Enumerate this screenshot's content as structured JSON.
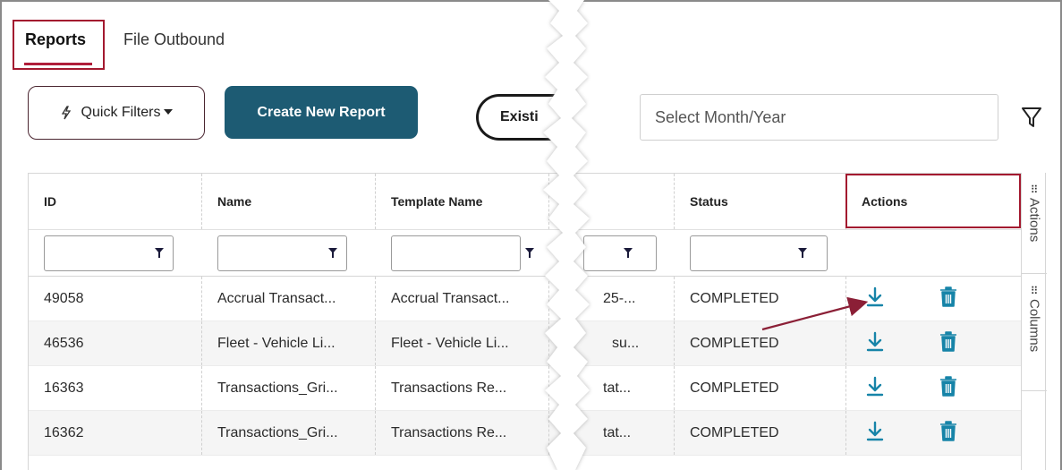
{
  "tabs": [
    {
      "label": "Reports",
      "active": true
    },
    {
      "label": "File Outbound",
      "active": false
    }
  ],
  "toolbar": {
    "quick_filters_label": "Quick Filters",
    "create_label": "Create New Report",
    "existing_label": "Existi",
    "month_placeholder": "Select Month/Year"
  },
  "table": {
    "columns": [
      "ID",
      "Name",
      "Template Name",
      "",
      "Status",
      "Actions"
    ],
    "rows": [
      {
        "id": "49058",
        "name": "Accrual Transact...",
        "template": "Accrual Transact...",
        "partial": "25-...",
        "status": "COMPLETED"
      },
      {
        "id": "46536",
        "name": "Fleet - Vehicle Li...",
        "template": "Fleet - Vehicle Li...",
        "partial": "su...",
        "status": "COMPLETED"
      },
      {
        "id": "16363",
        "name": "Transactions_Gri...",
        "template": "Transactions Re...",
        "partial": "tat...",
        "status": "COMPLETED"
      },
      {
        "id": "16362",
        "name": "Transactions_Gri...",
        "template": "Transactions Re...",
        "partial": "tat...",
        "status": "COMPLETED"
      }
    ]
  },
  "side_panel": {
    "actions_label": "Actions",
    "columns_label": "Columns"
  },
  "colors": {
    "primary": "#1d5b73",
    "highlight": "#a3192f",
    "action_icon": "#1784a8"
  },
  "icons": [
    "bolt-icon",
    "caret-down-icon",
    "filter-funnel-icon",
    "download-icon",
    "trash-icon",
    "grip-icon"
  ]
}
